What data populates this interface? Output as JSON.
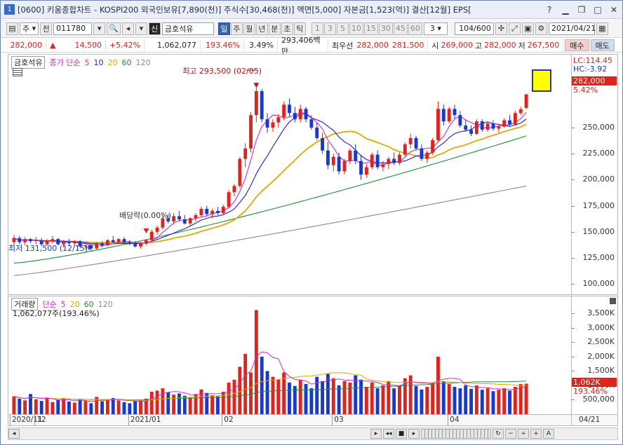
{
  "window": {
    "index": "1",
    "title": "[0600] 키움종합차트 - KOSPI200 외국인보유[7,890(천)] 주식수[30,468(천)] 액면[5,000] 자본금[1,523(억)] 결산[12월] EPS["
  },
  "toolbar": {
    "period_select": "주",
    "prev_label": "전",
    "code": "011780",
    "market_badge": "신",
    "stock_name": "금호석유",
    "periods": [
      "일",
      "주",
      "월",
      "년",
      "분",
      "초",
      "틱"
    ],
    "selected_period": "일",
    "minutes": [
      "1",
      "3",
      "5",
      "10",
      "15",
      "30",
      "45",
      "60"
    ],
    "minute_select": "3",
    "count": "104/600",
    "date": "2021/04/21"
  },
  "quote": {
    "price": "282,000",
    "change_arrow": "▲",
    "change": "14,500",
    "change_pct": "+5.42%",
    "volume": "1,062,077",
    "volume_ratio": "193.46%",
    "turnover": "3.49%",
    "amount": "293,406백만",
    "best_ask_label": "최우선",
    "best_ask": "282,000",
    "best_bid": "281,500",
    "open_label": "시",
    "open": "269,000",
    "high_label": "고",
    "high": "282,000",
    "low_label": "저",
    "low": "267,500",
    "buy": "매수",
    "sell": "매도"
  },
  "price_legend": {
    "name": "금호석유",
    "price_type": "종가 단순",
    "ma": [
      "5",
      "10",
      "20",
      "60",
      "120"
    ],
    "ma_colors": [
      "#d22bd2",
      "#1e1ee0",
      "#e6a800",
      "#1f8f3a",
      "#8c8c8c"
    ]
  },
  "price_axis": {
    "lc": "LC:114.45",
    "hc": "HC:-3.92",
    "current": "282,000",
    "current_pct": "5.42%",
    "ticks": [
      "250,000",
      "225,000",
      "200,000",
      "175,000",
      "150,000",
      "125,000",
      "100,000"
    ]
  },
  "annotations": {
    "high": "최고 293,500 (02/05)",
    "low": "최저 131,500 (12/15)",
    "dividend": "배당락(0.00%)"
  },
  "volume_legend": {
    "name": "거래량",
    "type": "단순",
    "ma": [
      "5",
      "20",
      "60",
      "120"
    ],
    "value_text": "1,062,077주(193.46%)"
  },
  "volume_axis": {
    "ticks": [
      "3,500K",
      "3,000K",
      "2,500K",
      "2,000K",
      "1,500K",
      "1,000K",
      "500,000"
    ],
    "current": "1,062K",
    "current_pct": "193.46%"
  },
  "date_axis": {
    "labels": [
      "2020/11",
      "12",
      "2021/01",
      "02",
      "03",
      "04"
    ],
    "right": "04/21"
  },
  "colors": {
    "up": "#e3221b",
    "down": "#1538d9",
    "ma5": "#d22bd2",
    "ma10": "#1e1ee0",
    "ma20": "#e6a800",
    "ma60": "#1f8f3a",
    "ma120": "#8c8c8c"
  },
  "chart_data": {
    "type": "candlestick",
    "unit": "KRW",
    "ylim": [
      90000,
      320000
    ],
    "ohlc": [
      [
        140000,
        147000,
        136000,
        144000
      ],
      [
        144000,
        146000,
        138000,
        140000
      ],
      [
        140000,
        145000,
        137000,
        143000
      ],
      [
        143000,
        144000,
        139000,
        141000
      ],
      [
        141000,
        145000,
        138000,
        142000
      ],
      [
        142000,
        144000,
        136000,
        138000
      ],
      [
        138000,
        143000,
        136000,
        141000
      ],
      [
        141000,
        146000,
        139000,
        143000
      ],
      [
        143000,
        144000,
        137000,
        138000
      ],
      [
        138000,
        142000,
        135000,
        140000
      ],
      [
        140000,
        143000,
        137000,
        139000
      ],
      [
        139000,
        142000,
        136000,
        141000
      ],
      [
        141000,
        142000,
        135000,
        136000
      ],
      [
        136000,
        139000,
        133000,
        137000
      ],
      [
        137000,
        138000,
        131500,
        134000
      ],
      [
        134000,
        140000,
        133000,
        139000
      ],
      [
        139000,
        141000,
        135000,
        137000
      ],
      [
        137000,
        143000,
        136000,
        142000
      ],
      [
        142000,
        146000,
        139000,
        140000
      ],
      [
        140000,
        144000,
        138000,
        143000
      ],
      [
        143000,
        145000,
        139000,
        140000
      ],
      [
        140000,
        142000,
        137000,
        139000
      ],
      [
        139000,
        141000,
        135000,
        136000
      ],
      [
        136000,
        140000,
        134000,
        139000
      ],
      [
        139000,
        143000,
        137000,
        142000
      ],
      [
        142000,
        152000,
        141000,
        150000
      ],
      [
        150000,
        156000,
        147000,
        154000
      ],
      [
        154000,
        166000,
        152000,
        163000
      ],
      [
        163000,
        167000,
        158000,
        160000
      ],
      [
        160000,
        168000,
        157000,
        165000
      ],
      [
        165000,
        170000,
        160000,
        162000
      ],
      [
        162000,
        166000,
        157000,
        158000
      ],
      [
        158000,
        164000,
        155000,
        163000
      ],
      [
        163000,
        168000,
        160000,
        166000
      ],
      [
        166000,
        174000,
        164000,
        172000
      ],
      [
        172000,
        175000,
        165000,
        167000
      ],
      [
        167000,
        172000,
        163000,
        170000
      ],
      [
        170000,
        174000,
        166000,
        168000
      ],
      [
        168000,
        176000,
        166000,
        174000
      ],
      [
        174000,
        190000,
        172000,
        188000
      ],
      [
        188000,
        196000,
        184000,
        194000
      ],
      [
        194000,
        222000,
        192000,
        220000
      ],
      [
        220000,
        235000,
        212000,
        230000
      ],
      [
        230000,
        265000,
        226000,
        262000
      ],
      [
        262000,
        293500,
        255000,
        285000
      ],
      [
        285000,
        287000,
        255000,
        258000
      ],
      [
        258000,
        264000,
        245000,
        250000
      ],
      [
        250000,
        258000,
        246000,
        255000
      ],
      [
        255000,
        263000,
        250000,
        260000
      ],
      [
        260000,
        275000,
        257000,
        272000
      ],
      [
        272000,
        278000,
        260000,
        264000
      ],
      [
        264000,
        270000,
        255000,
        258000
      ],
      [
        258000,
        272000,
        255000,
        268000
      ],
      [
        268000,
        270000,
        255000,
        258000
      ],
      [
        258000,
        262000,
        248000,
        250000
      ],
      [
        250000,
        255000,
        238000,
        240000
      ],
      [
        240000,
        245000,
        225000,
        228000
      ],
      [
        228000,
        236000,
        210000,
        214000
      ],
      [
        214000,
        225000,
        208000,
        222000
      ],
      [
        222000,
        226000,
        205000,
        208000
      ],
      [
        208000,
        220000,
        205000,
        218000
      ],
      [
        218000,
        230000,
        215000,
        228000
      ],
      [
        228000,
        234000,
        215000,
        218000
      ],
      [
        218000,
        224000,
        200000,
        205000
      ],
      [
        205000,
        215000,
        202000,
        212000
      ],
      [
        212000,
        226000,
        210000,
        224000
      ],
      [
        224000,
        228000,
        210000,
        212000
      ],
      [
        212000,
        218000,
        208000,
        215000
      ],
      [
        215000,
        222000,
        210000,
        220000
      ],
      [
        220000,
        226000,
        214000,
        216000
      ],
      [
        216000,
        226000,
        214000,
        224000
      ],
      [
        224000,
        236000,
        222000,
        234000
      ],
      [
        234000,
        244000,
        230000,
        240000
      ],
      [
        240000,
        242000,
        228000,
        230000
      ],
      [
        230000,
        234000,
        218000,
        220000
      ],
      [
        220000,
        228000,
        216000,
        226000
      ],
      [
        226000,
        240000,
        224000,
        238000
      ],
      [
        238000,
        275000,
        236000,
        268000
      ],
      [
        268000,
        272000,
        252000,
        256000
      ],
      [
        256000,
        270000,
        254000,
        268000
      ],
      [
        268000,
        272000,
        258000,
        262000
      ],
      [
        262000,
        266000,
        250000,
        252000
      ],
      [
        252000,
        258000,
        246000,
        248000
      ],
      [
        248000,
        252000,
        242000,
        244000
      ],
      [
        244000,
        258000,
        243000,
        256000
      ],
      [
        256000,
        258000,
        246000,
        248000
      ],
      [
        248000,
        256000,
        246000,
        254000
      ],
      [
        254000,
        257000,
        247000,
        249000
      ],
      [
        249000,
        253000,
        245000,
        251000
      ],
      [
        251000,
        259000,
        250000,
        257000
      ],
      [
        257000,
        262000,
        251000,
        253000
      ],
      [
        253000,
        266000,
        252000,
        264000
      ],
      [
        264000,
        270000,
        262000,
        267500
      ],
      [
        269000,
        282000,
        267500,
        282000
      ]
    ],
    "volume": [
      620,
      540,
      480,
      700,
      520,
      460,
      580,
      420,
      500,
      560,
      440,
      400,
      520,
      460,
      380,
      600,
      450,
      520,
      560,
      480,
      420,
      380,
      460,
      500,
      540,
      780,
      820,
      900,
      760,
      680,
      720,
      640,
      600,
      700,
      860,
      740,
      660,
      620,
      780,
      1100,
      1200,
      1650,
      2100,
      1450,
      3620,
      2000,
      1500,
      1300,
      1200,
      1450,
      1100,
      980,
      1200,
      1050,
      900,
      1300,
      1150,
      1400,
      1250,
      1000,
      1150,
      1100,
      1350,
      1200,
      950,
      1100,
      900,
      1000,
      1150,
      900,
      1000,
      1250,
      1350,
      980,
      860,
      950,
      1100,
      2000,
      1150,
      1050,
      950,
      900,
      1000,
      880,
      1000,
      850,
      900,
      800,
      850,
      900,
      820,
      950,
      1050,
      1062
    ]
  }
}
